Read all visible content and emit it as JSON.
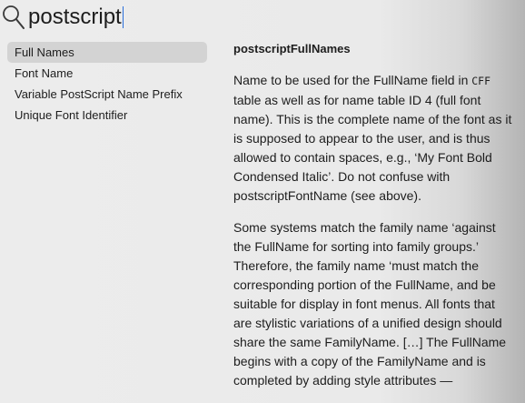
{
  "search": {
    "query": "postscript"
  },
  "sidebar": {
    "items": [
      {
        "label": "Full Names",
        "selected": true
      },
      {
        "label": "Font Name",
        "selected": false
      },
      {
        "label": "Variable PostScript Name Prefix",
        "selected": false
      },
      {
        "label": "Unique Font Identifier",
        "selected": false
      }
    ]
  },
  "detail": {
    "title": "postscriptFullNames",
    "para1_pre": "Name to be used for the FullName field in ",
    "para1_code": "CFF",
    "para1_post": " table as well as for name table ID 4 (full font name). This is the complete name of the font as it is supposed to appear to the user, and is thus allowed to contain spaces, e.g., ‘My Font Bold Condensed Italic’. Do not confuse with postscriptFontName (see above).",
    "para2": "Some systems match the family name ‘against the FullName for sorting into family groups.’ Therefore, the family name ‘must match the corresponding portion of the FullName, and be suitable for display in font menus. All fonts that are stylistic variations of a unified design should share the same FamilyName. […] The FullName begins with a copy of the FamilyName and is completed by adding style attributes —"
  },
  "colors": {
    "selection": "#d3d3d3",
    "caret": "#2a6fdb",
    "text": "#1d1d1d"
  },
  "icons": {
    "search": "magnifying-glass"
  }
}
